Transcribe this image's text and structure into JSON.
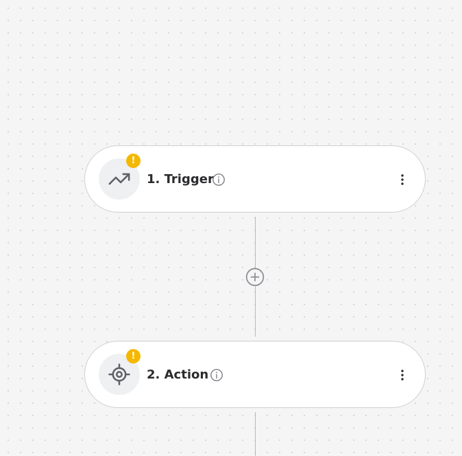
{
  "nodes": [
    {
      "title": "1. Trigger",
      "icon": "trending-up-icon",
      "badge": "!"
    },
    {
      "title": "2. Action",
      "icon": "target-icon",
      "badge": "!"
    }
  ],
  "colors": {
    "warning": "#f5b800",
    "canvas_bg": "#f5f5f6",
    "node_bg": "#ffffff",
    "icon_bg": "#eff0f2",
    "connector": "#b8b8bc"
  },
  "icons": {
    "info": "info-icon",
    "menu": "more-vertical-icon",
    "add": "plus-circle-icon"
  }
}
